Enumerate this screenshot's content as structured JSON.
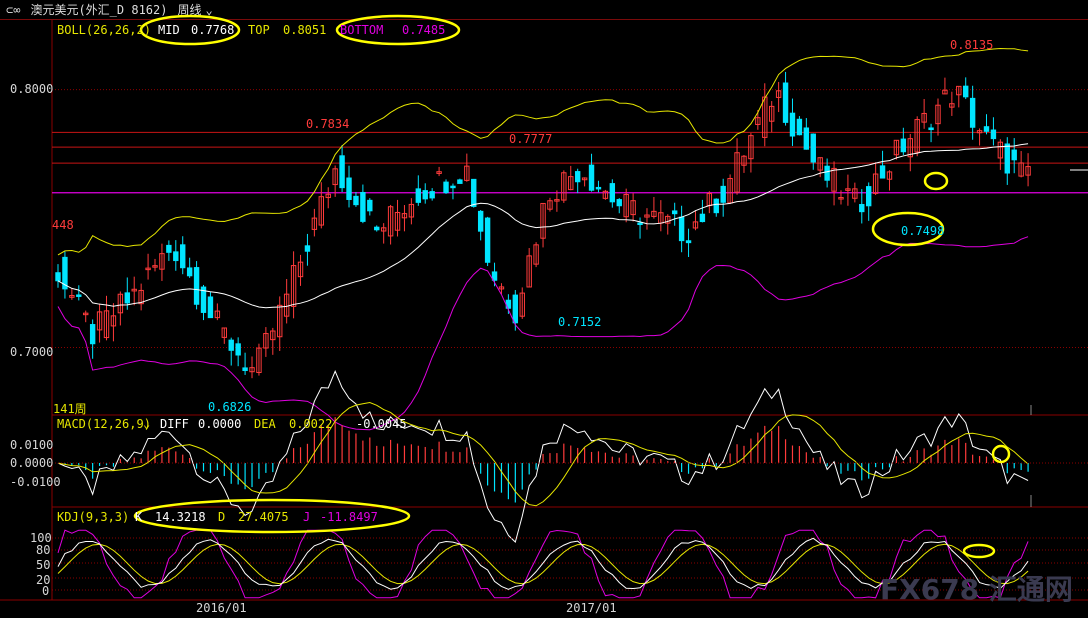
{
  "title_bar": {
    "back_glyph": "⊂∞",
    "symbol_title": "澳元美元(外汇_D 8162)",
    "period_label": "周线",
    "dropdown_icon": "chevron-down-icon"
  },
  "boll_panel": {
    "indicator": "BOLL(26,26,2)",
    "mid_label": "MID",
    "mid_value": "0.7768",
    "top_label": "TOP",
    "top_value": "0.8051",
    "bottom_label": "BOTTOM",
    "bottom_value": "0.7485",
    "y_ticks": [
      "0.8000",
      "0.7000"
    ],
    "left_marker": "448",
    "bottom_left_label": "141周",
    "annotations": [
      "0.8135",
      "0.7834",
      "0.7777",
      "0.7498",
      "0.7152",
      "0.6826"
    ]
  },
  "macd_panel": {
    "indicator": "MACD(12,26,9)",
    "diff_label": "DIFF",
    "diff_value": "0.0000",
    "dea_label": "DEA",
    "dea_value": "0.0022",
    "macd_value": "-0.0045",
    "y_ticks": [
      "0.0100",
      "0.0000",
      "-0.0100"
    ]
  },
  "kdj_panel": {
    "indicator": "KDJ(9,3,3)",
    "k_label": "K",
    "k_value": "14.3218",
    "d_label": "D",
    "d_value": "27.4075",
    "j_label": "J",
    "j_value": "-11.8497",
    "y_ticks": [
      "100",
      "80",
      "50",
      "20",
      "0"
    ]
  },
  "x_axis": [
    "2016/01",
    "2017/01"
  ],
  "watermark": "FX678 汇通网",
  "colors": {
    "up": "#ff3b3b",
    "down": "#00e5ff",
    "mid": "#ffffff",
    "top": "#e6e600",
    "bottom": "#e000e0",
    "grid": "#8a0000",
    "highlight": "#ffff00"
  },
  "chart_data": {
    "type": "candlestick",
    "title": "澳元美元(外汇_D 8162) 周线",
    "y_range": [
      0.675,
      0.82
    ],
    "key_levels": [
      {
        "label": "0.8135",
        "value": 0.8135
      },
      {
        "label": "0.7834",
        "value": 0.7834
      },
      {
        "label": "0.7777",
        "value": 0.7777
      },
      {
        "label": "0.7498",
        "value": 0.7498
      },
      {
        "label": "0.7152",
        "value": 0.7152
      },
      {
        "label": "0.6826",
        "value": 0.6826
      }
    ],
    "series": [
      {
        "name": "MID",
        "last": 0.7768
      },
      {
        "name": "TOP",
        "last": 0.8051
      },
      {
        "name": "BOTTOM",
        "last": 0.7485
      }
    ]
  }
}
